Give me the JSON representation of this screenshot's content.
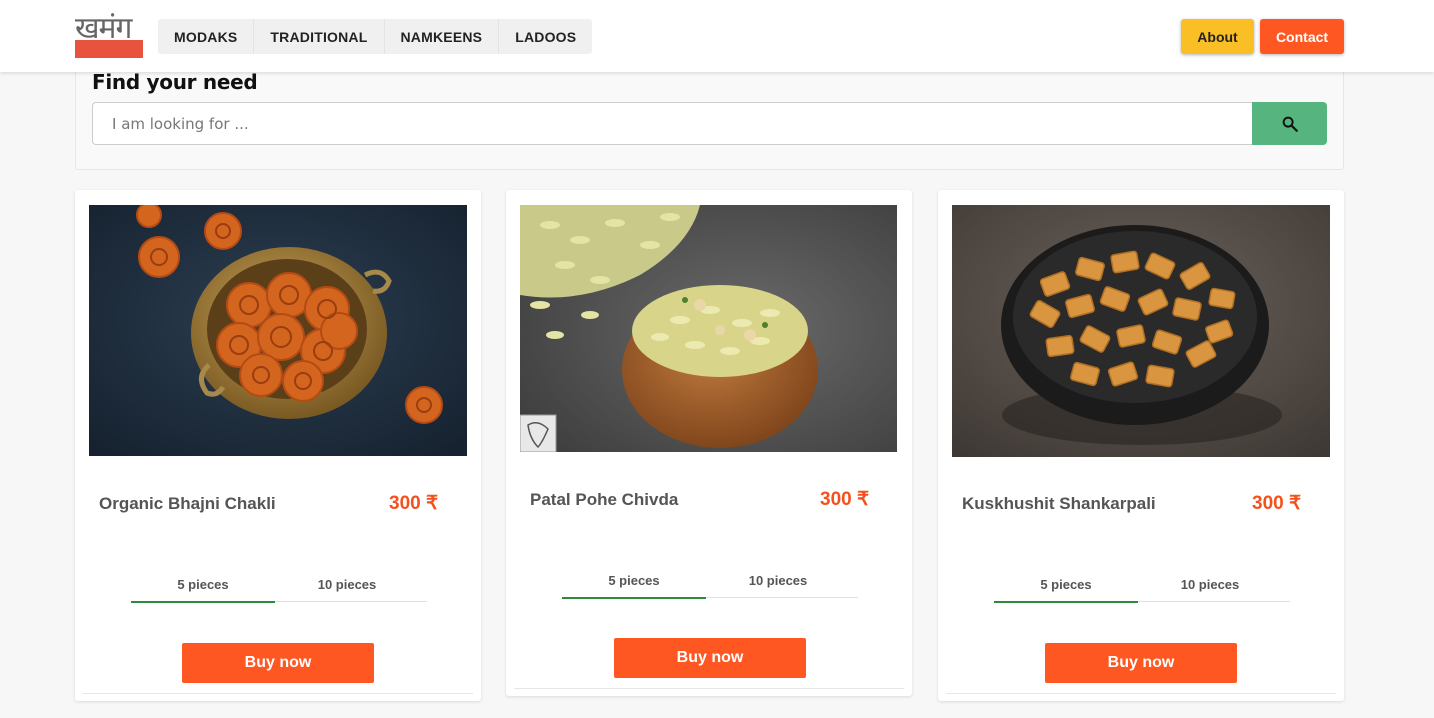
{
  "brand": {
    "logo_text": "खमंग",
    "accent": "#e8533f"
  },
  "nav": {
    "items": [
      {
        "label": "MODAKS"
      },
      {
        "label": "TRADITIONAL"
      },
      {
        "label": "NAMKEENS"
      },
      {
        "label": "LADOOS"
      }
    ]
  },
  "header": {
    "about_label": "About",
    "about_color": "#fbbf26",
    "contact_label": "Contact",
    "contact_color": "#ff5722"
  },
  "search": {
    "title": "Find your need",
    "placeholder": "I am looking for ...",
    "value": "",
    "button_icon": "search-icon",
    "button_color": "#56b57e"
  },
  "products": [
    {
      "name": "Organic Bhajni Chakli",
      "price": "300 ₹",
      "image": "chakli-in-brass-bowl",
      "tabs": [
        "5 pieces",
        "10 pieces"
      ],
      "selected_tab": "5 pieces",
      "buy_label": "Buy now"
    },
    {
      "name": "Patal Pohe Chivda",
      "price": "300 ₹",
      "image": "chivda-in-wooden-bowl",
      "tabs": [
        "5 pieces",
        "10 pieces"
      ],
      "selected_tab": "5 pieces",
      "buy_label": "Buy now"
    },
    {
      "name": "Kuskhushit Shankarpali",
      "price": "300 ₹",
      "image": "shankarpali-in-black-bowl",
      "tabs": [
        "5 pieces",
        "10 pieces"
      ],
      "selected_tab": "5 pieces",
      "buy_label": "Buy now"
    }
  ]
}
